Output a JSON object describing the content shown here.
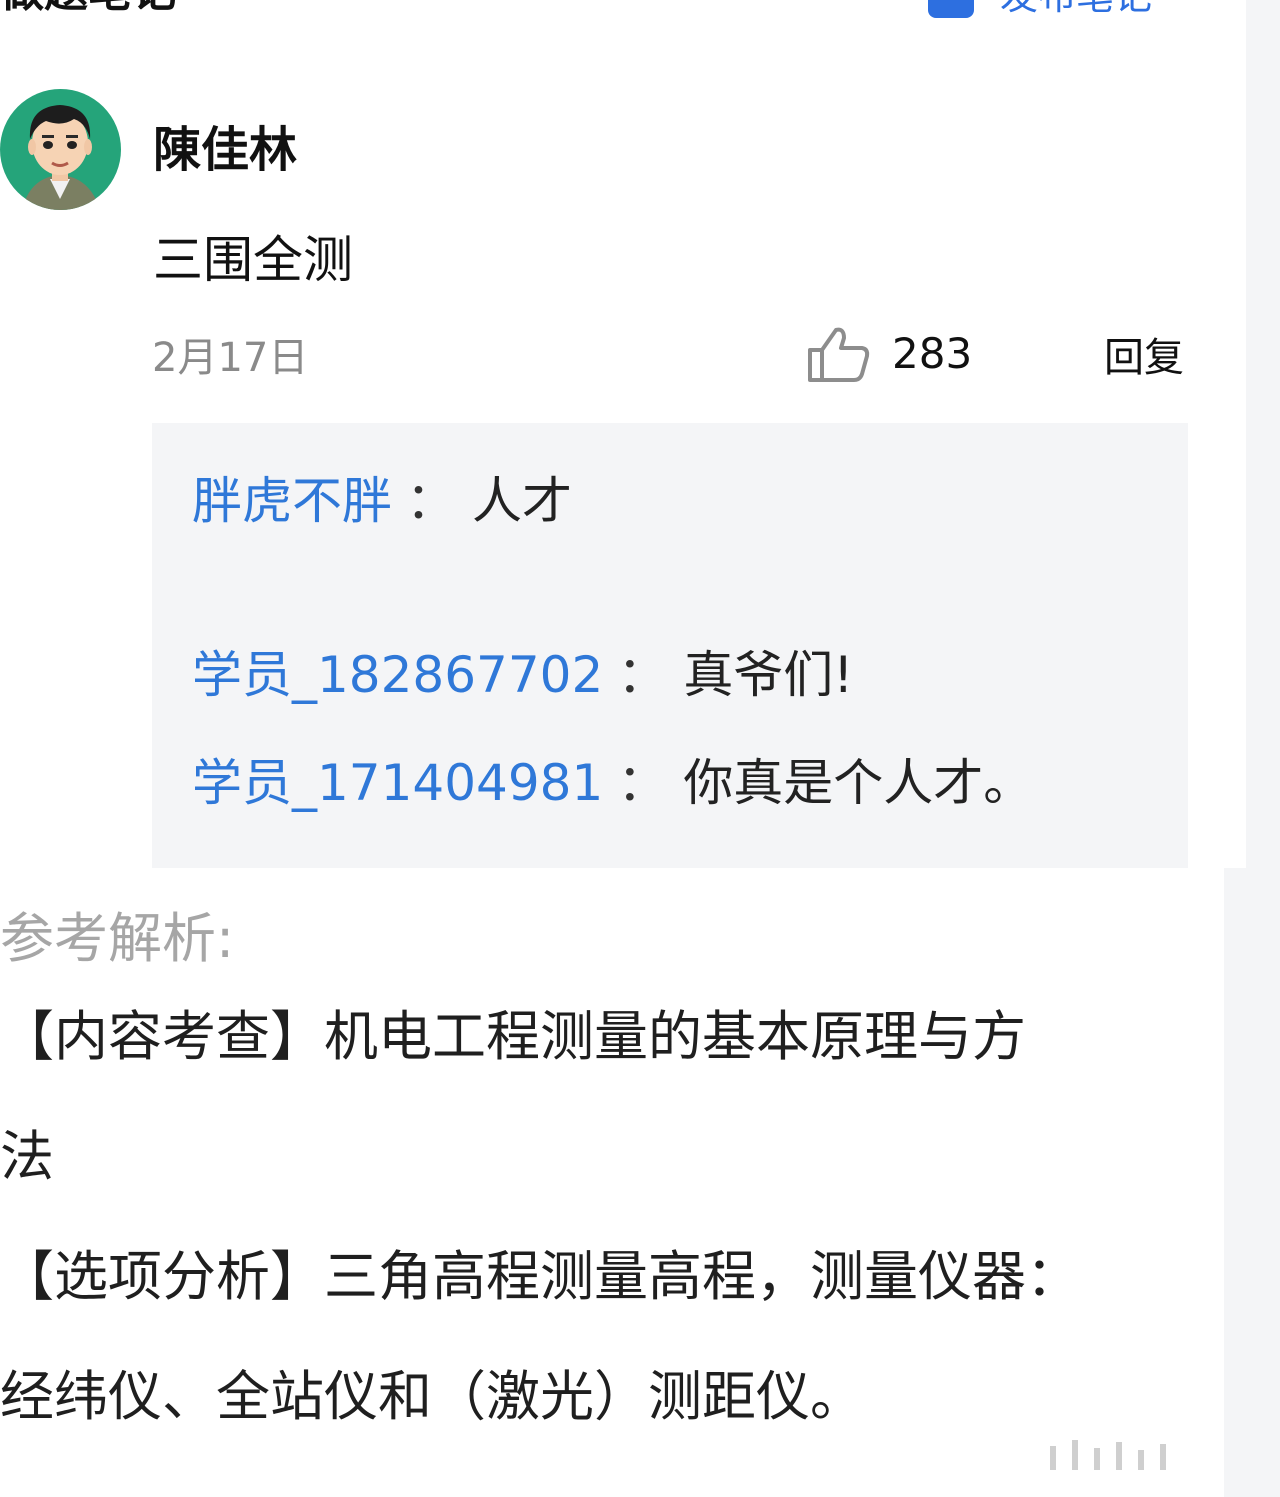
{
  "header": {
    "title": "做题笔记",
    "publish_label": "发布笔记"
  },
  "note": {
    "author": "陳佳林",
    "content": "三围全测",
    "date": "2月17日",
    "like_count": "283",
    "reply_label": "回复",
    "replies": [
      {
        "name": "胖虎不胖",
        "text": "人才"
      },
      {
        "name": "学员_182867702",
        "text": "真爷们!"
      },
      {
        "name": "学员_171404981",
        "text": "你真是个人才。"
      }
    ]
  },
  "analysis": {
    "title": "参考解析:",
    "line1": "【内容考查】机电工程测量的基本原理与方",
    "line2": "法",
    "line3": "【选项分析】三角高程测量高程，测量仪器：",
    "line4": "经纬仪、全站仪和（激光）测距仪。"
  },
  "colors": {
    "accent": "#2d6fe0",
    "link": "#2f78d8",
    "avatar_bg": "#25a47a",
    "reply_bg": "#f4f5f7"
  }
}
